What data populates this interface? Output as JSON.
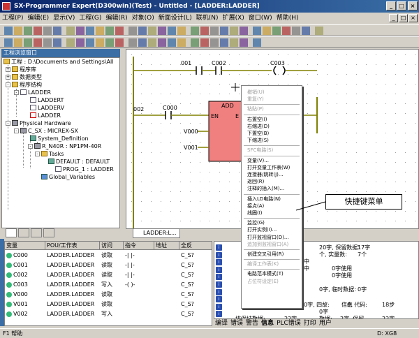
{
  "window": {
    "title": "SX-Programmer Expert(D300win)(Test) - Untitled - [LADDER:LADDER]",
    "btn_min": "_",
    "btn_max": "□",
    "btn_close": "×"
  },
  "menu": {
    "items": [
      "工程(P)",
      "编辑(E)",
      "显示(V)",
      "工程(G)",
      "编辑(R)",
      "对象(O)",
      "新面设计(L)",
      "联机(N)",
      "扩展(X)",
      "窗口(W)",
      "帮助(H)"
    ]
  },
  "project": {
    "title": "工程浏览窗口",
    "root": "工程 : D:\\Documents and Settings\\All",
    "items": [
      "程序库",
      "数据类型",
      "程序结构",
      "LADDER",
      "LADDERT",
      "LADDERV",
      "LADDER",
      "Physical Hardware",
      "C_SX : MICREX-SX",
      "System_Definition",
      "R_N40R : NP1PM-40R",
      "Tasks",
      "DEFAULT : DEFAULT",
      "PROG_1 : LADDER",
      "Global_Variables"
    ]
  },
  "editor": {
    "tab": "LADDER:L...",
    "contacts": [
      "001",
      "C002",
      "C003",
      "002",
      "C000",
      "V000",
      "V001"
    ],
    "fb_name": "ADD",
    "fb_in": "EN",
    "fb_out": "E"
  },
  "context_menu": {
    "items": [
      {
        "label": "撤销(U)",
        "enabled": false
      },
      {
        "label": "重复(Y)",
        "enabled": false
      },
      {
        "sep": true
      },
      {
        "label": "粘贴(P)",
        "enabled": false
      },
      {
        "sep": true
      },
      {
        "label": "右置空(I)",
        "enabled": true
      },
      {
        "label": "右缩进(D)",
        "enabled": true
      },
      {
        "label": "下置空(B)",
        "enabled": true
      },
      {
        "label": "下缩进(S)",
        "enabled": true
      },
      {
        "sep": true
      },
      {
        "label": "SFC电路(S)",
        "enabled": false
      },
      {
        "sep": true
      },
      {
        "label": "变量(V)...",
        "enabled": true
      },
      {
        "label": "打开变量工作表(W)",
        "enabled": true
      },
      {
        "label": "连接器/跳转(J)...",
        "enabled": true
      },
      {
        "label": "返回(R)",
        "enabled": true
      },
      {
        "label": "注释的插入(M)...",
        "enabled": true
      },
      {
        "sep": true
      },
      {
        "label": "插入LD电路(N)",
        "enabled": true
      },
      {
        "label": "接点(A)",
        "enabled": true
      },
      {
        "label": "线圈(I)",
        "enabled": true
      },
      {
        "sep": true
      },
      {
        "label": "监控(G)",
        "enabled": true
      },
      {
        "label": "打开实例(I)...",
        "enabled": true
      },
      {
        "label": "打开监视窗口(D)...",
        "enabled": true
      },
      {
        "label": "追加到监视窗口(A)",
        "enabled": false
      },
      {
        "sep": true
      },
      {
        "label": "创建交叉引用(R)",
        "enabled": true
      },
      {
        "sep": true
      },
      {
        "label": "编译工作表(K)",
        "enabled": false
      },
      {
        "sep": true
      },
      {
        "label": "电路范本模式(T)",
        "enabled": true
      },
      {
        "label": "占位符设定(E)",
        "enabled": false
      }
    ]
  },
  "callout": "快捷键菜单",
  "variables": {
    "headers": [
      "变量",
      "POU/工作表",
      "访问",
      "指令",
      "地址",
      "全反"
    ],
    "rows": [
      [
        "C000",
        "LADDER.LADDER",
        "读取",
        "-| |-",
        "",
        "C_S?"
      ],
      [
        "C001",
        "LADDER.LADDER",
        "读取",
        "-| |-",
        "",
        "C_S?"
      ],
      [
        "C002",
        "LADDER.LADDER",
        "读取",
        "-| |-",
        "",
        "C_S?"
      ],
      [
        "C003",
        "LADDER.LADDER",
        "写入",
        "-( )-",
        "",
        "C_S?"
      ],
      [
        "V000",
        "LADDER.LADDER",
        "读取",
        "",
        "",
        "C_S?"
      ],
      [
        "V001",
        "LADDER.LADDER",
        "读取",
        "",
        "",
        "C_S?"
      ],
      [
        "V002",
        "LADDER.LADDER",
        "写入",
        "",
        "",
        "C_S?"
      ]
    ]
  },
  "output": {
    "lines": [
      "20字, 保留数据:",
      "17字",
      "个, 实量数:",
      "7个",
      "中",
      "中",
      "0字使用",
      "0字使用",
      "0字, 临时数据:",
      "0字",
      "信息",
      "0字, 四故:",
      "0, 代码:",
      "18步",
      "0字",
      "数据:",
      "2字, 保留",
      "22字",
      "排保持数据:",
      "22字"
    ],
    "tabs": [
      "编译",
      "错误",
      "警告",
      "信息",
      "PLC错误",
      "打印",
      "用户"
    ]
  },
  "status": {
    "left": "F1 帮助",
    "right": "D: XG8"
  }
}
